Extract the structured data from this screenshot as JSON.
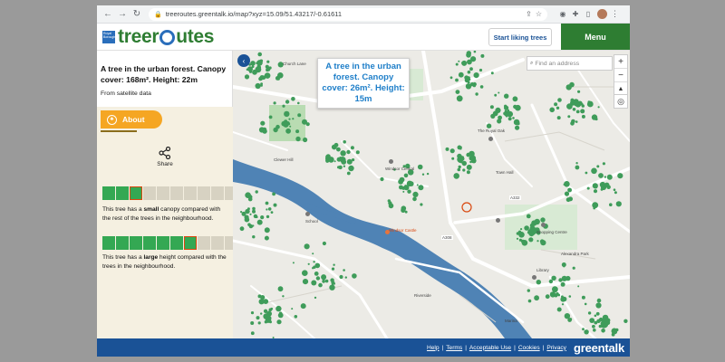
{
  "browser": {
    "url": "treeroutes.greentalk.io/map?xyz=15.09/51.43217/-0.61611"
  },
  "header": {
    "logo_badge": "Royal Borough",
    "logo_prefix": "treer",
    "logo_suffix": "utes",
    "start_btn": "Start liking trees",
    "menu_btn": "Menu"
  },
  "panel": {
    "title": "A tree in the urban forest. Canopy cover: 168m². Height: 22m",
    "source": "From satellite data",
    "about_tab": "About",
    "share_label": "Share",
    "canopy_bar": {
      "cells": 10,
      "filled": 3,
      "marked": 3
    },
    "canopy_caption_pre": "This tree has a ",
    "canopy_caption_bold": "small",
    "canopy_caption_post": " canopy compared with the rest of the trees in the neighbourhood.",
    "height_bar": {
      "cells": 10,
      "filled": 7,
      "marked": 7
    },
    "height_caption_pre": "This tree has a ",
    "height_caption_bold": "large",
    "height_caption_post": " height compared with the trees in the neighbourhood."
  },
  "map": {
    "tooltip": "A tree in the urban forest. Canopy cover: 26m². Height: 15m",
    "search_placeholder": "Find an address",
    "zoom_in": "+",
    "zoom_out": "−",
    "compass": "▲",
    "labels": {
      "church": "Church Lane",
      "pub": "The Royal Oak",
      "lane": "Clewer Hill",
      "school": "School",
      "museum": "Windsor Castle",
      "station": "Windsor Central",
      "riverside": "Riverside",
      "marina": "Marina",
      "park": "Alexandra Park",
      "shopping": "Shopping Centre",
      "hall": "Town Hall",
      "library": "Library",
      "a308": "A308",
      "a332": "A332"
    },
    "colors": {
      "water": "#4f83b5",
      "tree": "#3f9c5a",
      "park": "#b9dcb2",
      "road": "#ffffff"
    }
  },
  "footer": {
    "links": [
      "Help",
      "Terms",
      "Acceptable Use",
      "Cookies",
      "Privacy"
    ],
    "brand": "greentalk"
  }
}
